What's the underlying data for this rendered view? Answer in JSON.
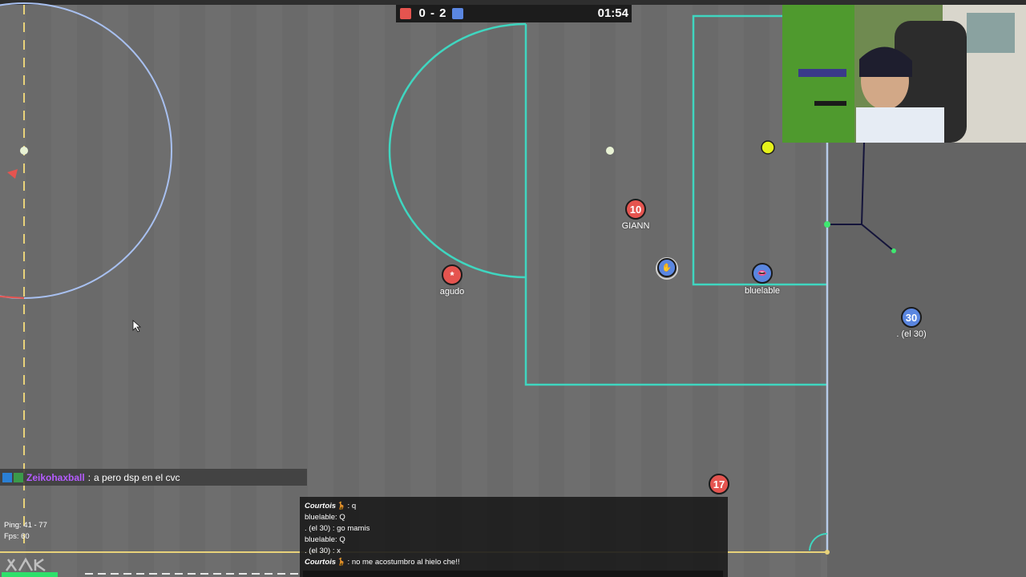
{
  "scoreboard": {
    "score": "0 - 2",
    "time": "01:54",
    "red_color": "#e5544f",
    "blue_color": "#5a86e0"
  },
  "players": [
    {
      "team": "red",
      "avatar": "10",
      "name": "GIANN"
    },
    {
      "team": "red",
      "avatar": "*",
      "name": "agudo"
    },
    {
      "team": "blue",
      "avatar": "✋",
      "name": ""
    },
    {
      "team": "blue",
      "avatar": "👄",
      "name": "bluelable"
    },
    {
      "team": "blue",
      "avatar": "30",
      "name": ". (el 30)"
    },
    {
      "team": "red",
      "avatar": "17",
      "name": ""
    }
  ],
  "twitch_chat": {
    "user": "Zeikohaxball",
    "message": "a pero dsp en el cvc",
    "user_color": "#b55cff"
  },
  "game_chat": [
    {
      "user": "Courtois🦒",
      "message": "q",
      "italic": true
    },
    {
      "user": "bluelable",
      "message": "Q",
      "italic": false
    },
    {
      "user": ". (el 30)",
      "message": "go mamis",
      "italic": false
    },
    {
      "user": "bluelable",
      "message": "Q",
      "italic": false
    },
    {
      "user": ". (el 30)",
      "message": "x",
      "italic": false
    },
    {
      "user": "Courtois🦒",
      "message": "no me acostumbro al hielo che!!",
      "italic": true
    }
  ],
  "stats": {
    "ping": "Ping: 41 - 77",
    "fps": "Fps: 60"
  },
  "field_colors": {
    "grass": "#6a6a6a",
    "box_line": "#3fd6c0",
    "circle_line": "#a8c0f0",
    "ball": "#e6f21a"
  }
}
